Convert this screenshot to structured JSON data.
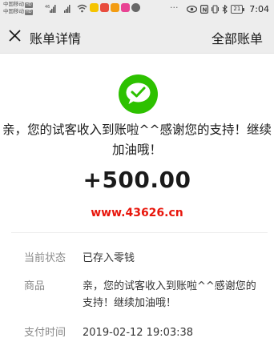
{
  "status_bar": {
    "carrier_1": "中国移动",
    "carrier_2": "中国移动",
    "hd_badge": "HD",
    "signal_1": "46",
    "more_dots": "···",
    "battery": "21",
    "time": "7:04",
    "icons": [
      "signal-icon",
      "wifi-icon",
      "app-notification-icon",
      "eye-icon",
      "nfc-icon",
      "vibrate-icon",
      "bluetooth-icon",
      "battery-icon"
    ]
  },
  "nav": {
    "close_icon": "close-icon",
    "title": "账单详情",
    "right_action": "全部账单"
  },
  "transaction": {
    "logo_icon": "wechat-pay-icon",
    "description": "亲，您的试客收入到账啦^^感谢您的支持！继续加油哦！",
    "amount": "+500.00",
    "watermark": "www.43626.cn"
  },
  "details": [
    {
      "label": "当前状态",
      "value": "已存入零钱"
    },
    {
      "label": "商品",
      "value": "亲，您的试客收入到账啦^^感谢您的支持！继续加油哦！"
    },
    {
      "label": "支付时间",
      "value": "2019-02-12 19:03:38"
    }
  ],
  "colors": {
    "bar_bg": "#ededed",
    "brand_green": "#2dc100",
    "watermark_red": "#e8160c",
    "label_gray": "#8a8a8a"
  }
}
